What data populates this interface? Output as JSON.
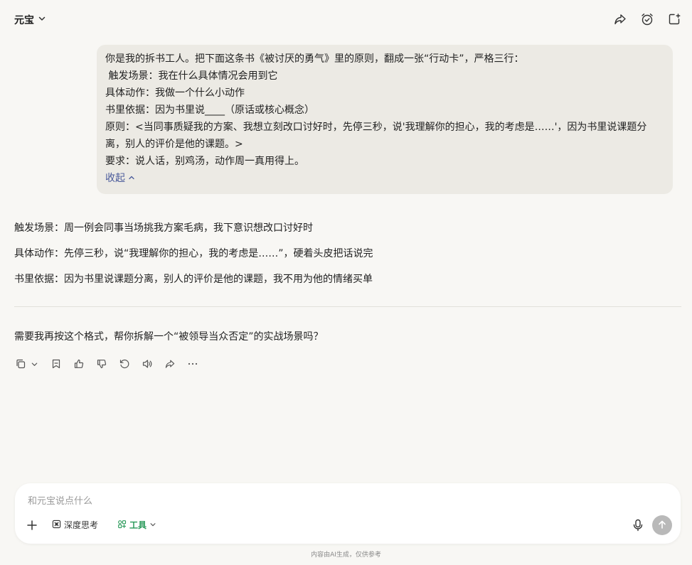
{
  "header": {
    "app_title": "元宝",
    "icons": [
      "share-icon",
      "alarm-clock-icon",
      "new-chat-icon"
    ]
  },
  "user_message": {
    "lines": [
      "你是我的拆书工人。把下面这条书《被讨厌的勇气》里的原则，翻成一张“行动卡”，严格三行：",
      " 触发场景：我在什么具体情况会用到它",
      "具体动作：我做一个什么小动作",
      "书里依据：因为书里说____（原话或核心概念）",
      "原则：<当同事质疑我的方案、我想立刻改口讨好时，先停三秒，说'我理解你的担心，我的考虑是……'，因为书里说课题分离，别人的评价是他的课题。>",
      "要求：说人话，别鸡汤，动作周一真用得上。"
    ],
    "collapse_label": "收起"
  },
  "answer": {
    "lines": [
      "触发场景：周一例会同事当场挑我方案毛病，我下意识想改口讨好时",
      "具体动作：先停三秒，说“我理解你的担心，我的考虑是……”，硬着头皮把话说完",
      "书里依据：因为书里说课题分离，别人的评价是他的课题，我不用为他的情绪买单"
    ],
    "followup": "需要我再按这个格式，帮你拆解一个“被领导当众否定”的实战场景吗？"
  },
  "action_icons": [
    "copy-icon",
    "chevron-down-icon",
    "bookmark-icon",
    "thumbs-up-icon",
    "thumbs-down-icon",
    "regenerate-icon",
    "speaker-icon",
    "share-icon",
    "more-icon"
  ],
  "composer": {
    "placeholder": "和元宝说点什么",
    "deep_think_label": "深度思考",
    "tools_label": "工具",
    "tools_color": "#2a9a5a"
  },
  "footer_note": "内容由AI生成，仅供参考"
}
